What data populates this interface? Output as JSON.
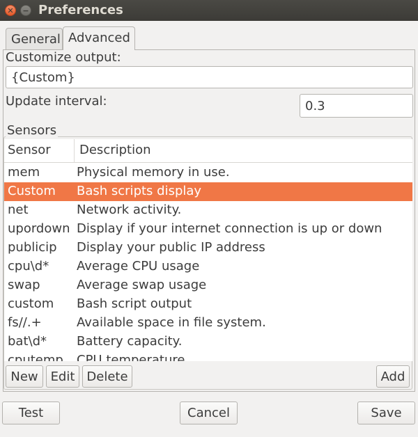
{
  "window": {
    "title": "Preferences"
  },
  "tabs": [
    {
      "label": "General"
    },
    {
      "label": "Advanced"
    }
  ],
  "advanced": {
    "customize_label": "Customize output:",
    "customize_value": "{Custom}",
    "interval_label": "Update interval:",
    "interval_value": "0.3",
    "sensors_label": "Sensors",
    "columns": [
      "Sensor",
      "Description"
    ],
    "rows": [
      {
        "sensor": "mem",
        "description": "Physical memory in use."
      },
      {
        "sensor": "Custom",
        "description": "Bash scripts display",
        "selected": true
      },
      {
        "sensor": "net",
        "description": "Network activity."
      },
      {
        "sensor": "upordown",
        "description": "Display if your internet connection is up or down"
      },
      {
        "sensor": "publicip",
        "description": "Display your public IP address"
      },
      {
        "sensor": "cpu\\d*",
        "description": "Average CPU usage"
      },
      {
        "sensor": "swap",
        "description": "Average swap usage"
      },
      {
        "sensor": "custom",
        "description": "Bash script output"
      },
      {
        "sensor": "fs//.+",
        "description": "Available space in file system."
      },
      {
        "sensor": "bat\\d*",
        "description": "Battery capacity."
      },
      {
        "sensor": "cputemp",
        "description": "CPU temperature"
      }
    ],
    "buttons": {
      "new": "New",
      "edit": "Edit",
      "delete": "Delete",
      "add": "Add"
    }
  },
  "footer": {
    "test": "Test",
    "cancel": "Cancel",
    "save": "Save"
  },
  "colors": {
    "selection": "#f07746",
    "titlebar": "#3c3b37"
  }
}
